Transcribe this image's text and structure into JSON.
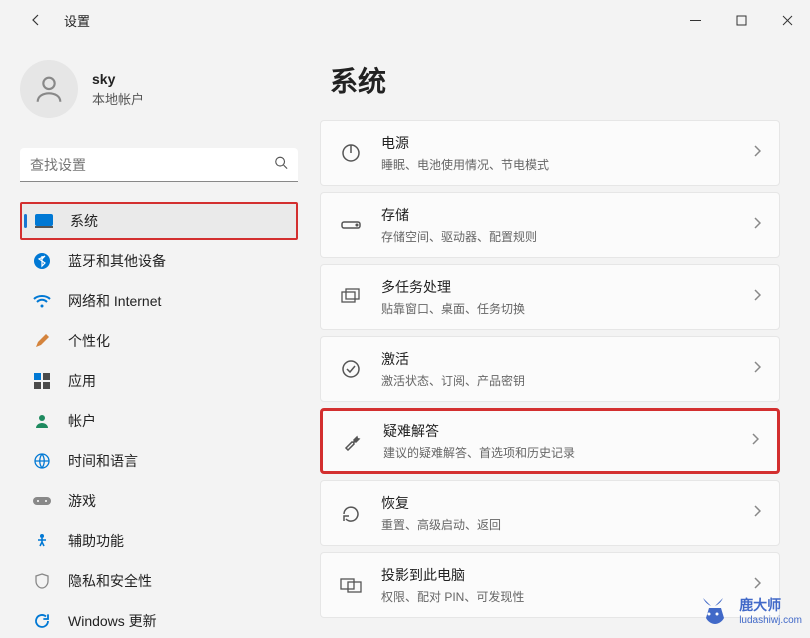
{
  "window": {
    "title": "设置"
  },
  "profile": {
    "name": "sky",
    "subtitle": "本地帐户"
  },
  "search": {
    "placeholder": "查找设置"
  },
  "nav": {
    "items": [
      {
        "icon": "system",
        "label": "系统",
        "active": true
      },
      {
        "icon": "bluetooth",
        "label": "蓝牙和其他设备"
      },
      {
        "icon": "network",
        "label": "网络和 Internet"
      },
      {
        "icon": "personalization",
        "label": "个性化"
      },
      {
        "icon": "apps",
        "label": "应用"
      },
      {
        "icon": "accounts",
        "label": "帐户"
      },
      {
        "icon": "time",
        "label": "时间和语言"
      },
      {
        "icon": "gaming",
        "label": "游戏"
      },
      {
        "icon": "accessibility",
        "label": "辅助功能"
      },
      {
        "icon": "privacy",
        "label": "隐私和安全性"
      },
      {
        "icon": "update",
        "label": "Windows 更新"
      }
    ]
  },
  "page": {
    "title": "系统"
  },
  "cards": [
    {
      "icon": "power",
      "title": "电源",
      "sub": "睡眠、电池使用情况、节电模式"
    },
    {
      "icon": "storage",
      "title": "存储",
      "sub": "存储空间、驱动器、配置规则"
    },
    {
      "icon": "multitask",
      "title": "多任务处理",
      "sub": "贴靠窗口、桌面、任务切换"
    },
    {
      "icon": "activation",
      "title": "激活",
      "sub": "激活状态、订阅、产品密钥"
    },
    {
      "icon": "troubleshoot",
      "title": "疑难解答",
      "sub": "建议的疑难解答、首选项和历史记录",
      "highlight": true
    },
    {
      "icon": "recovery",
      "title": "恢复",
      "sub": "重置、高级启动、返回"
    },
    {
      "icon": "project",
      "title": "投影到此电脑",
      "sub": "权限、配对 PIN、可发现性"
    }
  ],
  "watermark": {
    "brand": "鹿大师",
    "url": "ludashiwj.com"
  }
}
